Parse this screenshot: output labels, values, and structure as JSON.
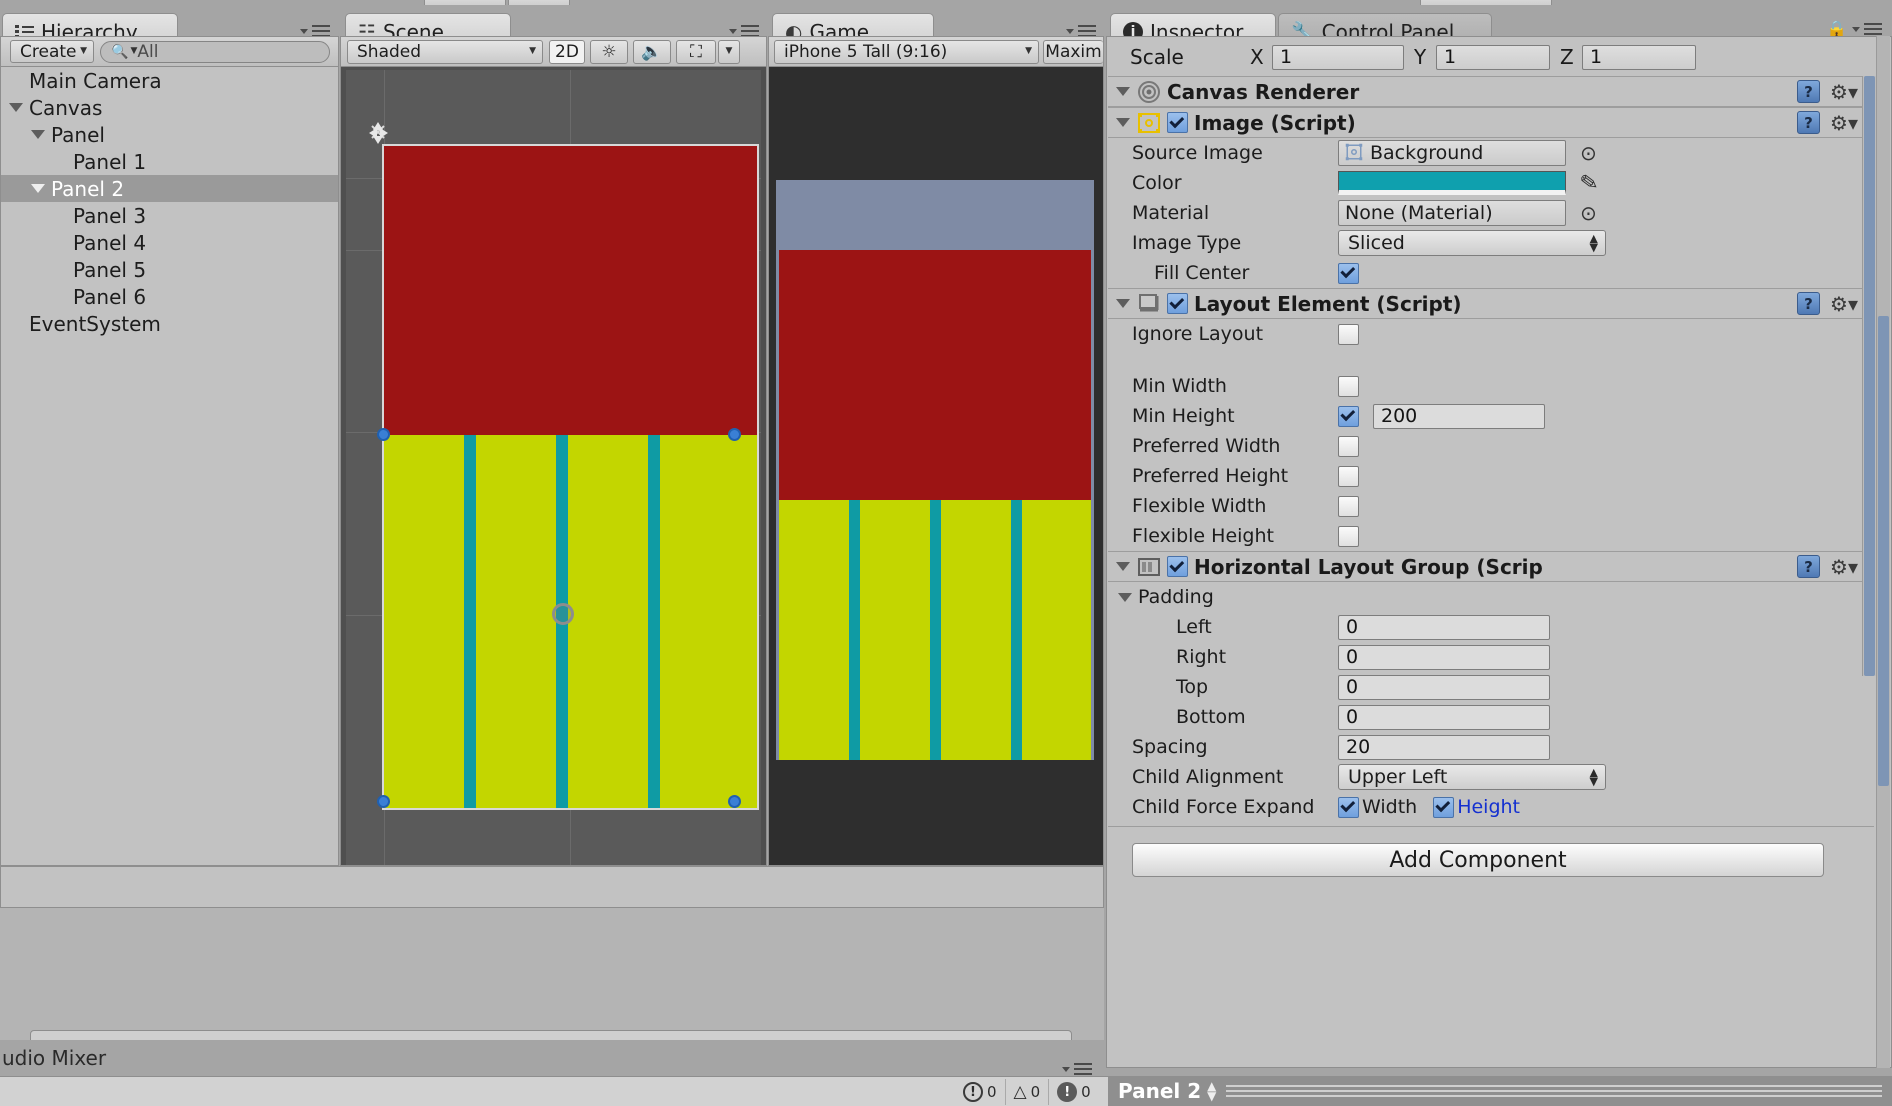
{
  "app": "Unity Editor",
  "panels": {
    "hierarchy": {
      "tab_label": "Hierarchy",
      "tab_icon": "hierarchy-icon",
      "create_label": "Create",
      "search_placeholder": "All",
      "search_value": "",
      "tree": [
        {
          "label": "Main Camera",
          "depth": 0,
          "expandable": false,
          "selected": false
        },
        {
          "label": "Canvas",
          "depth": 0,
          "expandable": true,
          "selected": false
        },
        {
          "label": "Panel",
          "depth": 1,
          "expandable": true,
          "selected": false
        },
        {
          "label": "Panel 1",
          "depth": 2,
          "expandable": false,
          "selected": false
        },
        {
          "label": "Panel 2",
          "depth": 1,
          "expandable": true,
          "selected": true
        },
        {
          "label": "Panel 3",
          "depth": 2,
          "expandable": false,
          "selected": false
        },
        {
          "label": "Panel 4",
          "depth": 2,
          "expandable": false,
          "selected": false
        },
        {
          "label": "Panel 5",
          "depth": 2,
          "expandable": false,
          "selected": false
        },
        {
          "label": "Panel 6",
          "depth": 2,
          "expandable": false,
          "selected": false
        },
        {
          "label": "EventSystem",
          "depth": 0,
          "expandable": false,
          "selected": false
        }
      ]
    },
    "scene": {
      "tab_label": "Scene",
      "tab_icon": "scene-grid-icon",
      "shading_mode": "Shaded",
      "mode_2d": "2D",
      "light_icon": "sun-icon",
      "audio_icon": "speaker-icon",
      "fx_icon": "image-effects-icon",
      "gizmo_icon": "gizmos-dropdown-icon"
    },
    "game": {
      "tab_label": "Game",
      "tab_icon": "game-pacman-icon",
      "aspect": "iPhone 5 Tall (9:16)",
      "maximize_label": "Maxim"
    },
    "inspector": {
      "tab_label": "Inspector",
      "tab_icon": "info-icon",
      "lock_icon": "lock-icon",
      "menu_icon": "panel-menu-icon",
      "transform_scale": {
        "label": "Scale",
        "x_label": "X",
        "x_value": "1",
        "y_label": "Y",
        "y_value": "1",
        "z_label": "Z",
        "z_value": "1"
      },
      "components": [
        {
          "name": "Canvas Renderer",
          "icon": "canvas-renderer-icon",
          "expanded": true,
          "has_checkbox": false,
          "help_icon": "help-icon",
          "gear_icon": "gear-icon",
          "rows": []
        },
        {
          "name": "Image (Script)",
          "icon": "image-script-icon",
          "expanded": true,
          "has_checkbox": true,
          "enabled": true,
          "help_icon": "help-icon",
          "gear_icon": "gear-icon",
          "rows": [
            {
              "label": "Source Image",
              "type": "object",
              "value": "Background",
              "icon": "sprite-icon",
              "picker": "object-picker-icon"
            },
            {
              "label": "Color",
              "type": "color",
              "value": "#0FA0AE",
              "picker": "eyedropper-icon"
            },
            {
              "label": "Material",
              "type": "object",
              "value": "None (Material)",
              "picker": "object-picker-icon"
            },
            {
              "label": "Image Type",
              "type": "enum",
              "value": "Sliced"
            },
            {
              "label": "Fill Center",
              "type": "checkbox",
              "value": true,
              "indent": 1
            }
          ]
        },
        {
          "name": "Layout Element (Script)",
          "icon": "layout-element-icon",
          "expanded": true,
          "has_checkbox": true,
          "enabled": true,
          "help_icon": "help-icon",
          "gear_icon": "gear-icon",
          "rows": [
            {
              "label": "Ignore Layout",
              "type": "checkbox",
              "value": false
            },
            {
              "label": "",
              "type": "spacer"
            },
            {
              "label": "Min Width",
              "type": "checkbox",
              "value": false
            },
            {
              "label": "Min Height",
              "type": "checkbox-number",
              "value": true,
              "number": "200"
            },
            {
              "label": "Preferred Width",
              "type": "checkbox",
              "value": false
            },
            {
              "label": "Preferred Height",
              "type": "checkbox",
              "value": false
            },
            {
              "label": "Flexible Width",
              "type": "checkbox",
              "value": false
            },
            {
              "label": "Flexible Height",
              "type": "checkbox",
              "value": false
            }
          ]
        },
        {
          "name": "Horizontal Layout Group (Scrip",
          "icon": "horizontal-layout-icon",
          "expanded": true,
          "has_checkbox": true,
          "enabled": true,
          "help_icon": "help-icon",
          "gear_icon": "gear-icon",
          "rows": [
            {
              "label": "Padding",
              "type": "foldout",
              "expanded": true
            },
            {
              "label": "Left",
              "type": "number",
              "value": "0",
              "indent": 2
            },
            {
              "label": "Right",
              "type": "number",
              "value": "0",
              "indent": 2
            },
            {
              "label": "Top",
              "type": "number",
              "value": "0",
              "indent": 2
            },
            {
              "label": "Bottom",
              "type": "number",
              "value": "0",
              "indent": 2
            },
            {
              "label": "Spacing",
              "type": "number",
              "value": "20"
            },
            {
              "label": "Child Alignment",
              "type": "enum",
              "value": "Upper Left"
            },
            {
              "label": "Child Force Expand",
              "type": "dual-checkbox",
              "a_label": "Width",
              "a_value": true,
              "b_label": "Height",
              "b_value": true,
              "b_highlight": "#1430d0"
            }
          ]
        }
      ],
      "add_component_label": "Add Component"
    },
    "control_panel": {
      "tab_label": "Control Panel",
      "tab_icon": "wrench-icon"
    },
    "project": {
      "audio_mixer_tab": "udio Mixer"
    }
  },
  "footer": {
    "selected_object": "Panel 2",
    "console_errors": "0",
    "console_warnings": "0",
    "console_infos": "0"
  },
  "scene_content": {
    "red_panel_color": "#9C1414",
    "green_panel_color": "#C3D600",
    "teal_bar_color": "#0F9BA4",
    "game_bg_color": "#2E2E2E",
    "canvas_border_color": "#D8D8D8",
    "green_children_count": 4
  }
}
